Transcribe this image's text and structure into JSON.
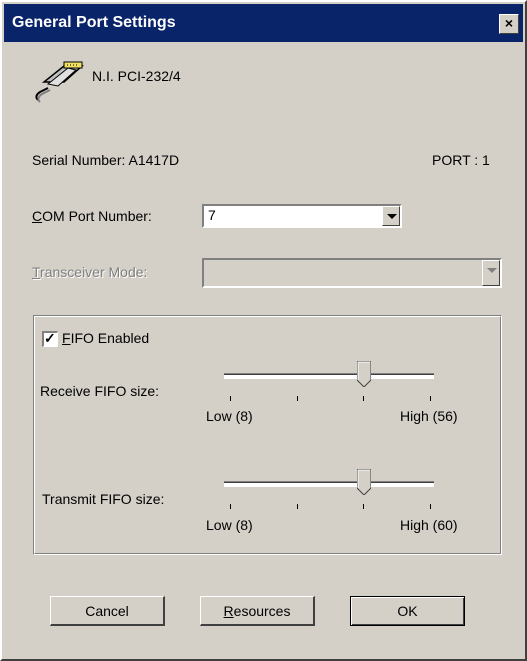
{
  "window": {
    "title": "General Port Settings",
    "close_label": "×"
  },
  "device": {
    "name": "N.I. PCI-232/4",
    "icon": "serial-cable-icon",
    "serial_label": "Serial Number: A1417D",
    "port_label": "PORT : 1"
  },
  "com_port": {
    "label_first": "C",
    "label_rest": "OM Port Number:",
    "value": "7"
  },
  "transceiver": {
    "label_first": "T",
    "label_rest": "ransceiver Mode:",
    "value": ""
  },
  "fifo": {
    "checkbox_checked": true,
    "label_first": "F",
    "label_rest": "IFO Enabled",
    "receive": {
      "label": "Receive FIFO size:",
      "low": "Low (8)",
      "high": "High (56)",
      "level": 0.67
    },
    "transmit": {
      "label": "Transmit FIFO size:",
      "low": "Low (8)",
      "high": "High (60)",
      "level": 0.67
    }
  },
  "buttons": {
    "cancel": "Cancel",
    "resources_first": "R",
    "resources_rest": "esources",
    "ok": "OK"
  }
}
